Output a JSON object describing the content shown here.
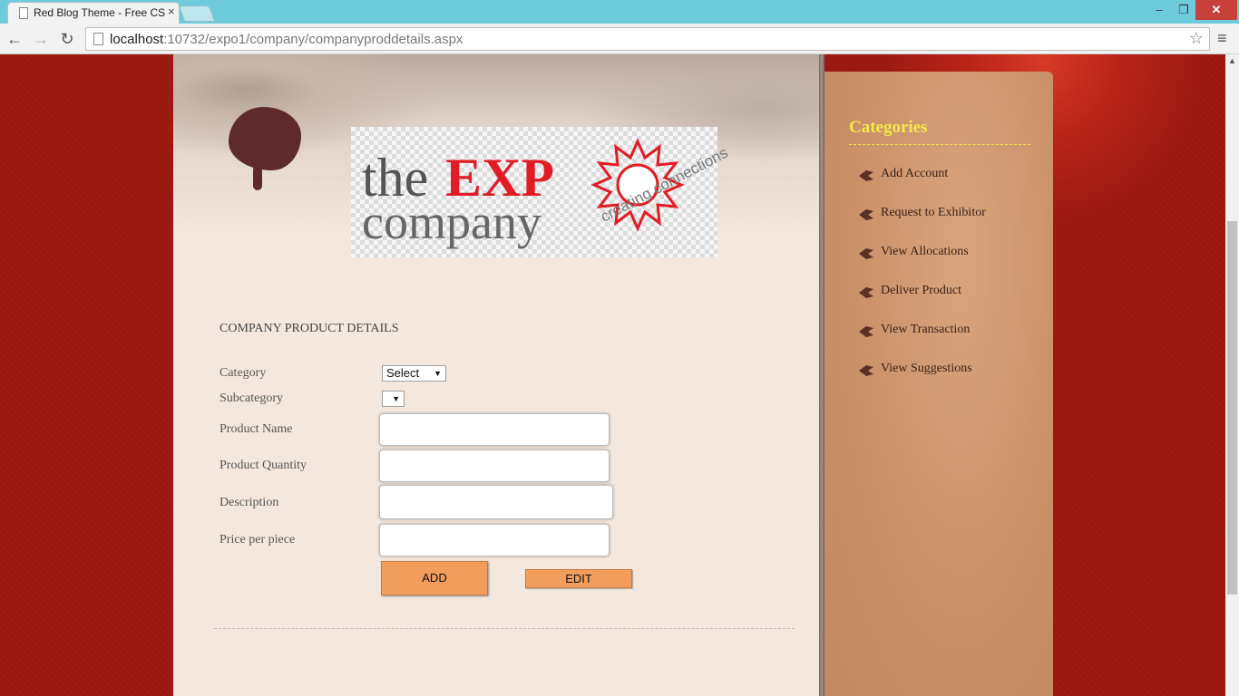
{
  "browser": {
    "tab_title": "Red Blog Theme - Free CS",
    "tab_close": "×",
    "url_host": "localhost",
    "url_path": ":10732/expo1/company/companyproddetails.aspx",
    "win_min": "–",
    "win_max": "❐",
    "win_close": "✕",
    "back": "←",
    "forward": "→",
    "reload": "↻",
    "star": "☆",
    "menu": "≡"
  },
  "logo": {
    "the": "the",
    "exp": "EXP",
    "company": "company",
    "tagline": "creating connections"
  },
  "form": {
    "title": "COMPANY PRODUCT DETAILS",
    "category_label": "Category",
    "category_value": "Select",
    "subcategory_label": "Subcategory",
    "subcategory_value": "",
    "product_name_label": "Product Name",
    "product_quantity_label": "Product Quantity",
    "description_label": "Description",
    "price_label": "Price per piece",
    "add_label": "ADD",
    "edit_label": "EDIT"
  },
  "sidebar": {
    "heading": "Categories",
    "items": [
      {
        "label": "Add Account"
      },
      {
        "label": "Request to Exhibitor"
      },
      {
        "label": "View Allocations"
      },
      {
        "label": "Deliver Product"
      },
      {
        "label": "View Transaction"
      },
      {
        "label": "View Suggestions"
      }
    ]
  },
  "colors": {
    "background": "#a01c14",
    "content": "#f4e8de",
    "sidebar": "#d29a72",
    "heading": "#f5e94a",
    "button": "#f09d5e",
    "logo_red": "#e11c25"
  }
}
